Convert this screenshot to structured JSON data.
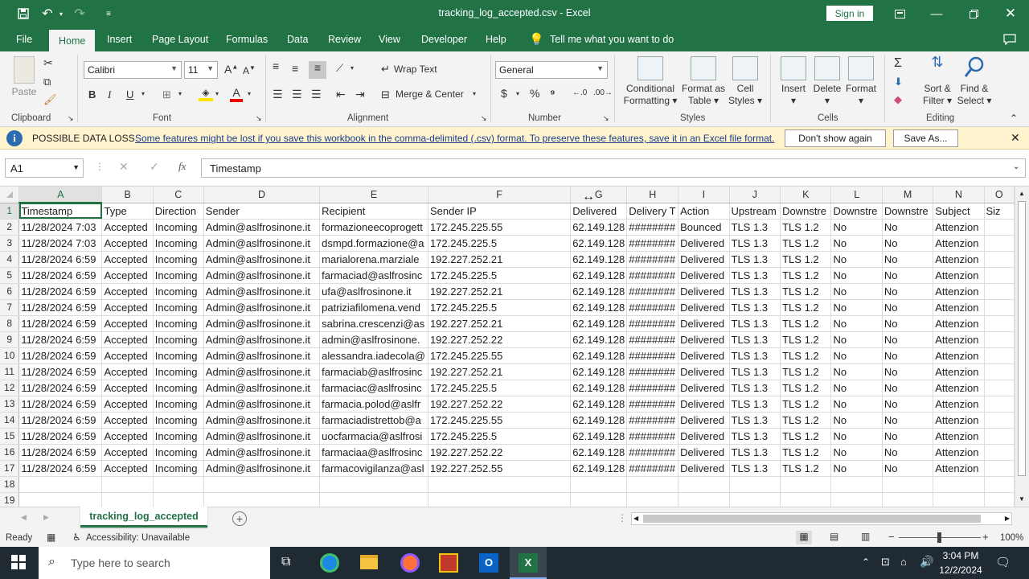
{
  "window": {
    "title": "tracking_log_accepted.csv  -  Excel",
    "sign_in": "Sign in"
  },
  "tabs": [
    "File",
    "Home",
    "Insert",
    "Page Layout",
    "Formulas",
    "Data",
    "Review",
    "View",
    "Developer",
    "Help"
  ],
  "tell_me": "Tell me what you want to do",
  "ribbon": {
    "paste": "Paste",
    "font_name": "Calibri",
    "font_size": "11",
    "wrap_text": "Wrap Text",
    "merge_center": "Merge & Center",
    "number_format": "General",
    "cond_fmt": [
      "Conditional",
      "Formatting ▾"
    ],
    "fmt_table": [
      "Format as",
      "Table ▾"
    ],
    "cell_styles": [
      "Cell",
      "Styles ▾"
    ],
    "insert": "Insert",
    "delete": "Delete",
    "format": "Format",
    "sort_filter": [
      "Sort &",
      "Filter ▾"
    ],
    "find_select": [
      "Find &",
      "Select ▾"
    ],
    "groups": {
      "clipboard": "Clipboard",
      "font": "Font",
      "alignment": "Alignment",
      "number": "Number",
      "styles": "Styles",
      "cells": "Cells",
      "editing": "Editing"
    }
  },
  "message": {
    "title": "POSSIBLE DATA LOSS",
    "text": "Some features might be lost if you save this workbook in the comma-delimited (.csv) format. To preserve these features, save it in an Excel file format.",
    "dont_show": "Don't show again",
    "save_as": "Save As..."
  },
  "formula_bar": {
    "name_box": "A1",
    "content": "Timestamp"
  },
  "grid": {
    "columns": [
      "A",
      "B",
      "C",
      "D",
      "E",
      "F",
      "G",
      "H",
      "I",
      "J",
      "K",
      "L",
      "M",
      "N",
      "O"
    ],
    "row_numbers": [
      "1",
      "2",
      "3",
      "4",
      "5",
      "6",
      "7",
      "8",
      "9",
      "10",
      "11",
      "12",
      "13",
      "14",
      "15",
      "16",
      "17",
      "18",
      "19"
    ],
    "header_row": [
      "Timestamp",
      "Type",
      "Direction",
      "Sender",
      "Recipient",
      "Sender IP",
      "Delivered",
      "Delivery T",
      "Action",
      "Upstream",
      "Downstre",
      "Downstre",
      "Downstre",
      "Subject",
      "Siz"
    ],
    "rows": [
      [
        "11/28/2024 7:03",
        "Accepted",
        "Incoming",
        "Admin@aslfrosinone.it",
        "formazioneecoprogett",
        "172.245.225.55",
        "62.149.128",
        "########",
        "Bounced",
        "TLS 1.3",
        "TLS 1.2",
        "No",
        "No",
        "Attenzion",
        ""
      ],
      [
        "11/28/2024 7:03",
        "Accepted",
        "Incoming",
        "Admin@aslfrosinone.it",
        "dsmpd.formazione@a",
        "172.245.225.5",
        "62.149.128",
        "########",
        "Delivered",
        "TLS 1.3",
        "TLS 1.2",
        "No",
        "No",
        "Attenzion",
        ""
      ],
      [
        "11/28/2024 6:59",
        "Accepted",
        "Incoming",
        "Admin@aslfrosinone.it",
        "marialorena.marziale",
        "192.227.252.21",
        "62.149.128",
        "########",
        "Delivered",
        "TLS 1.3",
        "TLS 1.2",
        "No",
        "No",
        "Attenzion",
        ""
      ],
      [
        "11/28/2024 6:59",
        "Accepted",
        "Incoming",
        "Admin@aslfrosinone.it",
        "farmaciad@aslfrosinc",
        "172.245.225.5",
        "62.149.128",
        "########",
        "Delivered",
        "TLS 1.3",
        "TLS 1.2",
        "No",
        "No",
        "Attenzion",
        ""
      ],
      [
        "11/28/2024 6:59",
        "Accepted",
        "Incoming",
        "Admin@aslfrosinone.it",
        "ufa@aslfrosinone.it",
        "192.227.252.21",
        "62.149.128",
        "########",
        "Delivered",
        "TLS 1.3",
        "TLS 1.2",
        "No",
        "No",
        "Attenzion",
        ""
      ],
      [
        "11/28/2024 6:59",
        "Accepted",
        "Incoming",
        "Admin@aslfrosinone.it",
        "patriziafilomena.vend",
        "172.245.225.5",
        "62.149.128",
        "########",
        "Delivered",
        "TLS 1.3",
        "TLS 1.2",
        "No",
        "No",
        "Attenzion",
        ""
      ],
      [
        "11/28/2024 6:59",
        "Accepted",
        "Incoming",
        "Admin@aslfrosinone.it",
        "sabrina.crescenzi@as",
        "192.227.252.21",
        "62.149.128",
        "########",
        "Delivered",
        "TLS 1.3",
        "TLS 1.2",
        "No",
        "No",
        "Attenzion",
        ""
      ],
      [
        "11/28/2024 6:59",
        "Accepted",
        "Incoming",
        "Admin@aslfrosinone.it",
        "admin@aslfrosinone.",
        "192.227.252.22",
        "62.149.128",
        "########",
        "Delivered",
        "TLS 1.3",
        "TLS 1.2",
        "No",
        "No",
        "Attenzion",
        ""
      ],
      [
        "11/28/2024 6:59",
        "Accepted",
        "Incoming",
        "Admin@aslfrosinone.it",
        "alessandra.iadecola@",
        "172.245.225.55",
        "62.149.128",
        "########",
        "Delivered",
        "TLS 1.3",
        "TLS 1.2",
        "No",
        "No",
        "Attenzion",
        ""
      ],
      [
        "11/28/2024 6:59",
        "Accepted",
        "Incoming",
        "Admin@aslfrosinone.it",
        "farmaciab@aslfrosinc",
        "192.227.252.21",
        "62.149.128",
        "########",
        "Delivered",
        "TLS 1.3",
        "TLS 1.2",
        "No",
        "No",
        "Attenzion",
        ""
      ],
      [
        "11/28/2024 6:59",
        "Accepted",
        "Incoming",
        "Admin@aslfrosinone.it",
        "farmaciac@aslfrosinc",
        "172.245.225.5",
        "62.149.128",
        "########",
        "Delivered",
        "TLS 1.3",
        "TLS 1.2",
        "No",
        "No",
        "Attenzion",
        ""
      ],
      [
        "11/28/2024 6:59",
        "Accepted",
        "Incoming",
        "Admin@aslfrosinone.it",
        "farmacia.polod@aslfr",
        "192.227.252.22",
        "62.149.128",
        "########",
        "Delivered",
        "TLS 1.3",
        "TLS 1.2",
        "No",
        "No",
        "Attenzion",
        ""
      ],
      [
        "11/28/2024 6:59",
        "Accepted",
        "Incoming",
        "Admin@aslfrosinone.it",
        "farmaciadistrettob@a",
        "172.245.225.55",
        "62.149.128",
        "########",
        "Delivered",
        "TLS 1.3",
        "TLS 1.2",
        "No",
        "No",
        "Attenzion",
        ""
      ],
      [
        "11/28/2024 6:59",
        "Accepted",
        "Incoming",
        "Admin@aslfrosinone.it",
        "uocfarmacia@aslfrosi",
        "172.245.225.5",
        "62.149.128",
        "########",
        "Delivered",
        "TLS 1.3",
        "TLS 1.2",
        "No",
        "No",
        "Attenzion",
        ""
      ],
      [
        "11/28/2024 6:59",
        "Accepted",
        "Incoming",
        "Admin@aslfrosinone.it",
        "farmaciaa@aslfrosinc",
        "192.227.252.22",
        "62.149.128",
        "########",
        "Delivered",
        "TLS 1.3",
        "TLS 1.2",
        "No",
        "No",
        "Attenzion",
        ""
      ],
      [
        "11/28/2024 6:59",
        "Accepted",
        "Incoming",
        "Admin@aslfrosinone.it",
        "farmacovigilanza@asl",
        "192.227.252.55",
        "62.149.128",
        "########",
        "Delivered",
        "TLS 1.3",
        "TLS 1.2",
        "No",
        "No",
        "Attenzion",
        ""
      ]
    ]
  },
  "sheet_tab": "tracking_log_accepted",
  "status": {
    "ready": "Ready",
    "accessibility": "Accessibility: Unavailable",
    "zoom": "100%"
  },
  "taskbar": {
    "search_placeholder": "Type here to search",
    "time": "3:04 PM",
    "date": "12/2/2024"
  },
  "colors": {
    "excel_green": "#217346",
    "info_bar": "#fff4ce",
    "taskbar": "#1f2a33"
  }
}
